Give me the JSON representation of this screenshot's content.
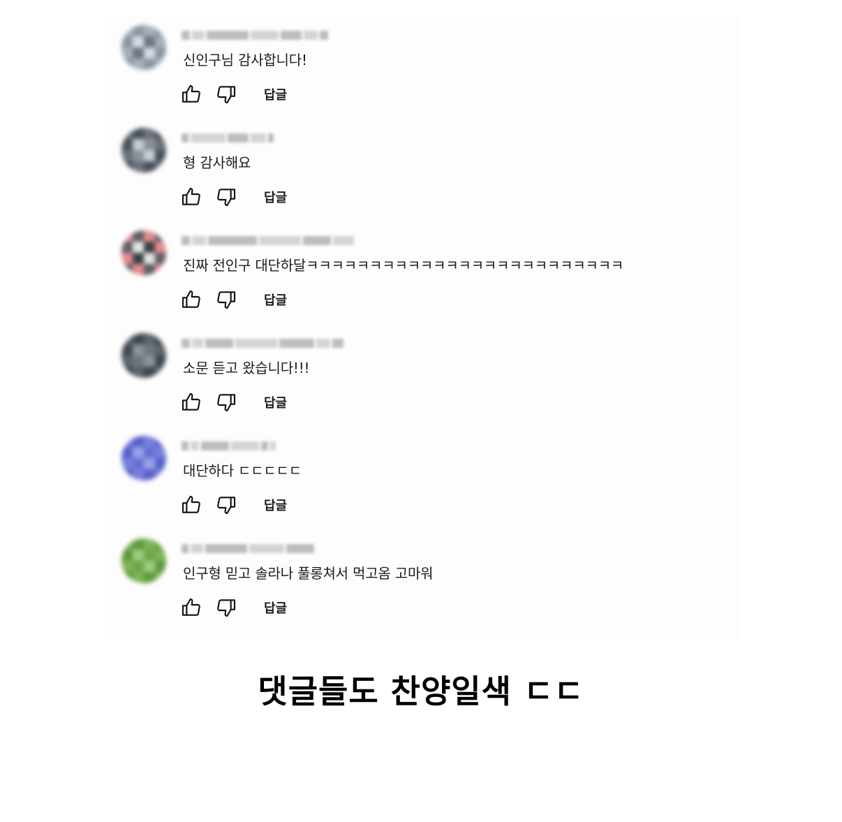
{
  "comments": [
    {
      "text": "신인구님 감사합니다!",
      "avatar_colors": [
        "#a7afba",
        "#8b95a3",
        "#d6dbe1",
        "#6b7684"
      ]
    },
    {
      "text": "형 감사해요",
      "avatar_colors": [
        "#6c737c",
        "#49515b",
        "#c7ccd2",
        "#8a9199"
      ]
    },
    {
      "text": "진짜 전인구 대단하달ㅋㅋㅋㅋㅋㅋㅋㅋㅋㅋㅋㅋㅋㅋㅋㅋㅋㅋㅋㅋㅋㅋㅋㅋㅋ",
      "avatar_colors": [
        "#e58b8b",
        "#5c6166",
        "#e4e4e4",
        "#3c4045"
      ]
    },
    {
      "text": "소문 듣고 왔습니다!!!",
      "avatar_colors": [
        "#5d646d",
        "#3f4750",
        "#8c939b",
        "#6f767e"
      ]
    },
    {
      "text": "대단하다 ㄷㄷㄷㄷㄷ",
      "avatar_colors": [
        "#7880dc",
        "#5961c9",
        "#9aa0e8",
        "#6870d4"
      ]
    },
    {
      "text": "인구형 믿고 솔라나 풀롱쳐서 먹고옴  고마워",
      "avatar_colors": [
        "#7fb35a",
        "#5f9a3b",
        "#a2cb81",
        "#6ca64a"
      ]
    }
  ],
  "actions": {
    "reply_label": "답글",
    "like_icon": "thumbs-up-icon",
    "dislike_icon": "thumbs-down-icon"
  },
  "caption": "댓글들도 찬양일색 ㄷㄷ"
}
